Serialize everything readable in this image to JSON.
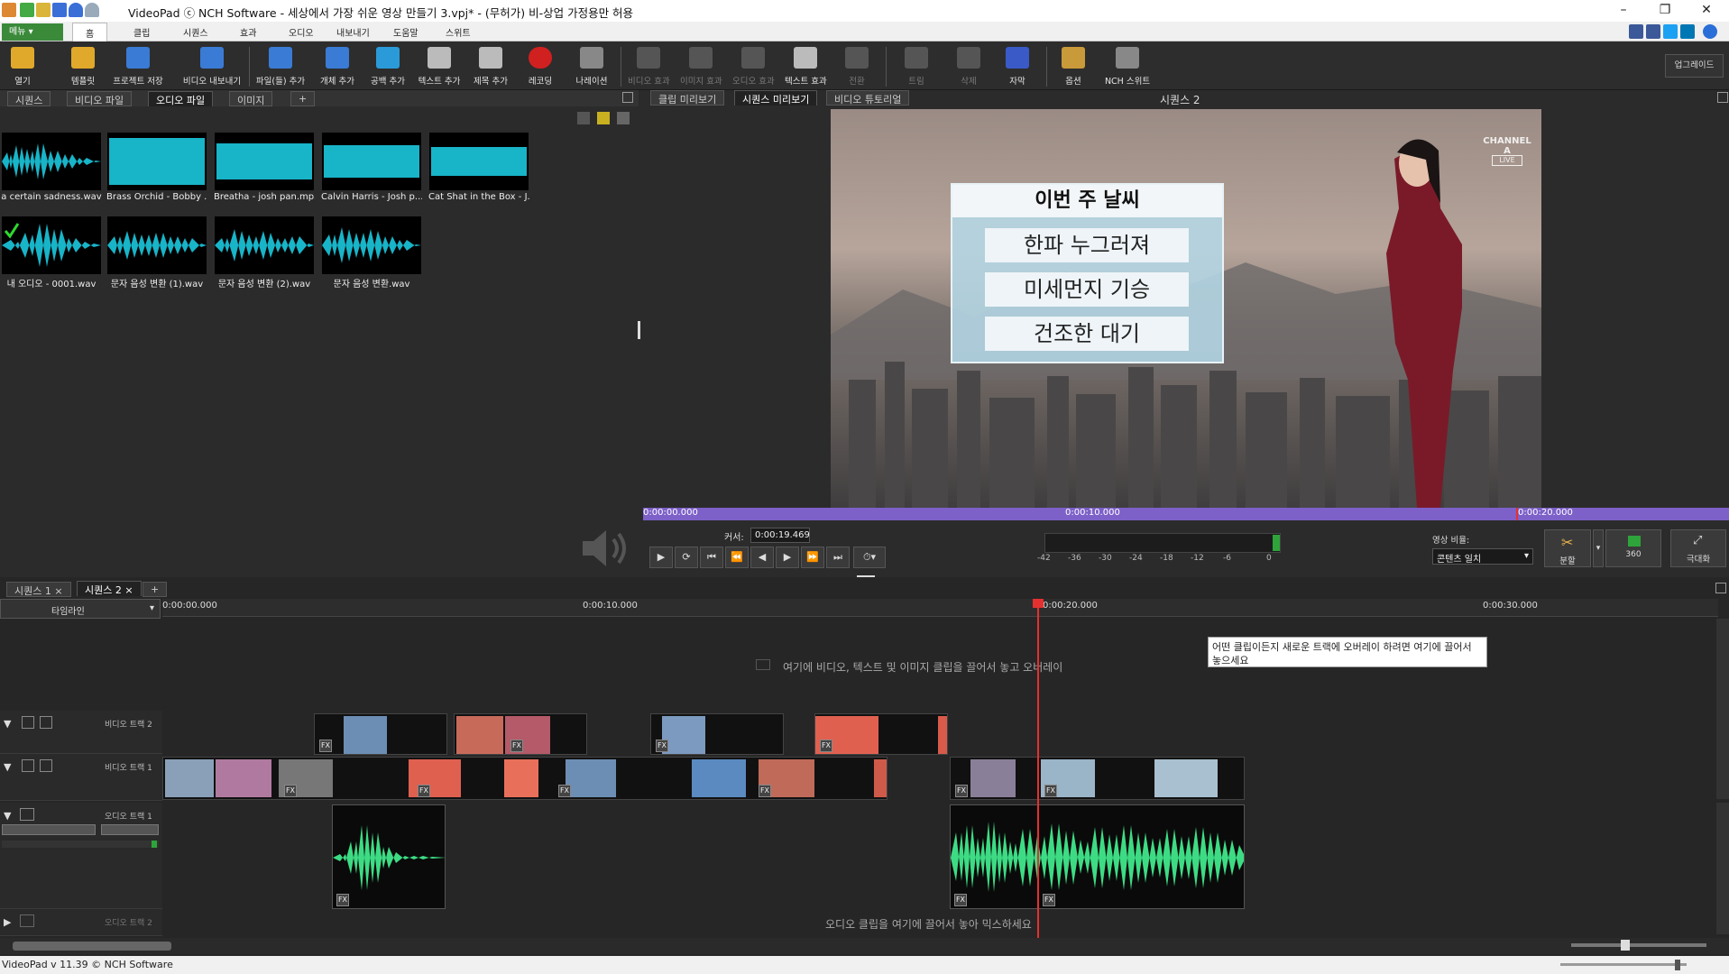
{
  "titlebar": {
    "title": "VideoPad ⓒ NCH Software - 세상에서 가장 쉬운 영상 만들기 3.vpj* - (무허가) 비-상업 가정용만 허용",
    "minimize": "–",
    "restore": "❐",
    "close": "✕"
  },
  "menubar": {
    "menu_label": "메뉴 ▾",
    "tabs": [
      "홈",
      "클립",
      "시퀀스",
      "효과",
      "오디오",
      "내보내기",
      "도움말",
      "스위트"
    ]
  },
  "toolbar": {
    "buttons": [
      "열기",
      "템플릿",
      "프로젝트 저장",
      "비디오 내보내기",
      "파일(들) 추가",
      "개체 추가",
      "공백 추가",
      "텍스트 추가",
      "제목 추가",
      "레코딩",
      "나레이션",
      "비디오 효과",
      "이미지 효과",
      "오디오 효과",
      "텍스트 효과",
      "전환",
      "트림",
      "삭제",
      "자막",
      "옵션",
      "NCH 스위트"
    ],
    "upgrade": "업그레이드"
  },
  "bin": {
    "tabs": [
      "시퀀스",
      "비디오 파일",
      "오디오 파일",
      "이미지"
    ],
    "add_tab": "+",
    "files": [
      "a certain sadness.wav",
      "Brass Orchid - Bobby ...",
      "Breatha - josh pan.mp3",
      "Calvin Harris - Josh p...",
      "Cat Shat in the Box - J...",
      "내 오디오 - 0001.wav",
      "문자 음성 변환 (1).wav",
      "문자 음성 변환 (2).wav",
      "문자 음성 변환.wav"
    ]
  },
  "preview": {
    "tabs": [
      "클립 미리보기",
      "시퀀스 미리보기",
      "비디오 튜토리얼"
    ],
    "sequence_name": "시퀀스 2",
    "overlay": {
      "title": "이번 주 날씨",
      "lines": [
        "한파 누그러져",
        "미세먼지 기승",
        "건조한 대기"
      ],
      "channel_logo": "CHANNEL A",
      "live": "LIVE"
    },
    "timebar": [
      "0:00:00.000",
      "0:00:10.000",
      "0:00:20.000"
    ],
    "cursor_label": "커서:",
    "cursor_value": "0:00:19.469",
    "meter_ticks": [
      "-42",
      "-36",
      "-30",
      "-24",
      "-18",
      "-12",
      "-6",
      "0"
    ],
    "ratio_label": "영상 비율:",
    "ratio_value": "콘텐츠 일치",
    "split_label": "분할",
    "vr_label": "360",
    "fullscreen_label": "극대화"
  },
  "timeline": {
    "seq_tabs": [
      "시퀀스 1",
      "시퀀스 2"
    ],
    "add_tab": "+",
    "mode": "타임라인",
    "ruler": [
      "0:00:00.000",
      "0:00:10.000",
      "0:00:20.000",
      "0:00:30.000"
    ],
    "overlay_hint": "여기에 비디오, 텍스트 및 이미지 클립을 끌어서 놓고 오버레이",
    "tooltip": "어떤 클립이든지 새로운 트랙에 오버레이 하려면 여기에 끌어서 놓으세요",
    "tracks": {
      "video2": "비디오 트랙 2",
      "video1": "비디오 트랙 1",
      "audio1": "오디오 트랙 1",
      "audio2": "오디오 트랙 2"
    },
    "audio_hint": "오디오 클립을 여기에 끌어서 놓아 믹스하세요"
  },
  "statusbar": {
    "text": "VideoPad v 11.39 © NCH Software"
  },
  "colors": {
    "accent_purple": "#7d60c8",
    "waveform_blue": "#18b4c8",
    "waveform_green": "#3ddc84",
    "playhead": "#e53030"
  }
}
